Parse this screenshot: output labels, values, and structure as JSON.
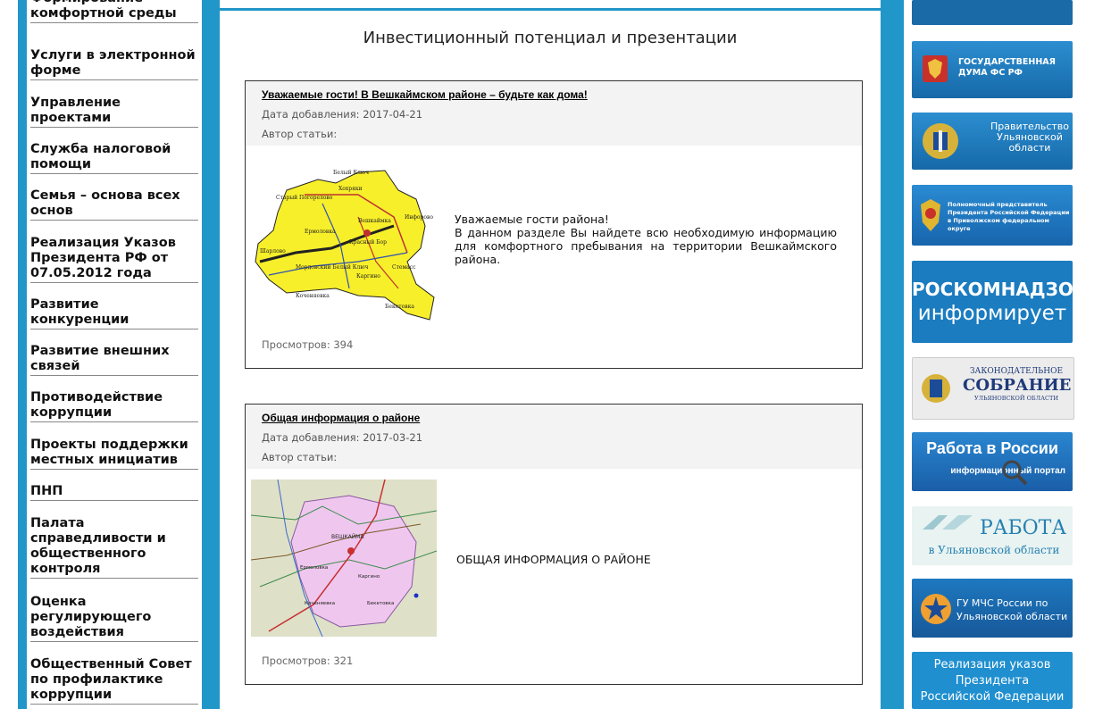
{
  "nav": {
    "items": [
      {
        "label": "Формирование комфортной среды"
      },
      {
        "label": "Услуги в электронной форме"
      },
      {
        "label": "Управление проектами"
      },
      {
        "label": "Служба налоговой помощи"
      },
      {
        "label": "Семья – основа всех основ"
      },
      {
        "label": "Реализация Указов Президента РФ от 07.05.2012 года"
      },
      {
        "label": "Развитие конкуренции"
      },
      {
        "label": "Развитие внешних связей"
      },
      {
        "label": "Противодействие коррупции"
      },
      {
        "label": "Проекты поддержки местных инициатив"
      },
      {
        "label": "ПНП"
      },
      {
        "label": "Палата справедливости и общественного контроля"
      },
      {
        "label": "Оценка регулирующего воздействия"
      },
      {
        "label": "Общественный Совет по профилактике коррупции"
      }
    ]
  },
  "main": {
    "title": "Инвестиционный потенциал и презентации",
    "articles": [
      {
        "title": "Уважаемые гости! В Вешкаймском районе – будьте как дома!",
        "date": "Дата добавления: 2017-04-21",
        "author": "Автор статьи:",
        "text_line1": "Уважаемые гости района!",
        "text_line2": "В данном разделе Вы найдете всю необходимую информацию для комфортного пребывания на территории Вешкаймского района.",
        "views": "Просмотров: 394"
      },
      {
        "title": "Общая информация о районе",
        "date": "Дата добавления: 2017-03-21",
        "author": "Автор статьи:",
        "text_line1": "ОБЩАЯ ИНФОРМАЦИЯ О РАЙОНЕ",
        "views": "Просмотров: 321"
      }
    ],
    "map_labels": [
      "Белый Ключ",
      "Хохряки",
      "Вешкаймка",
      "Ермоловка",
      "Красный Бор",
      "Шарлово",
      "Мордовский Белый Ключ",
      "Каргино",
      "Стемасс",
      "Коченяевка",
      "Бекетовка",
      "Инфорово",
      "Старый Погорелово"
    ],
    "map2_labels": [
      "ВЕШКАЙМА",
      "Ермоловка",
      "Каргино",
      "Бекетовка",
      "Коченяевка"
    ]
  },
  "banners": [
    {
      "line1": "ГОСУДАРСТВЕННАЯ",
      "line2": "ДУМА ФС РФ"
    },
    {
      "line1": "Правительство",
      "line2": "Ульяновской",
      "line3": "области"
    },
    {
      "line1": "Полномочный представитель",
      "line2": "Президента Российской Федерации",
      "line3": "в Приволжском федеральном округе"
    },
    {
      "line1": "РОСКОМНАДЗОР",
      "line2": "информирует"
    },
    {
      "line1": "ЗАКОНОДАТЕЛЬНОЕ",
      "line2": "СОБРАНИЕ",
      "line3": "УЛЬЯНОВСКОЙ ОБЛАСТИ"
    },
    {
      "line1": "Работа в России",
      "line2": "информационный портал"
    },
    {
      "line1": "РАБОТА",
      "line2": "в Ульяновской области"
    },
    {
      "line1": "ГУ МЧС России по",
      "line2": "Ульяновской области"
    },
    {
      "line1": "Реализация указов",
      "line2": "Президента",
      "line3": "Российской Федерации"
    }
  ],
  "colors": {
    "accent_blue": "#2196c8",
    "banner_blue": "#1a7cb8"
  }
}
